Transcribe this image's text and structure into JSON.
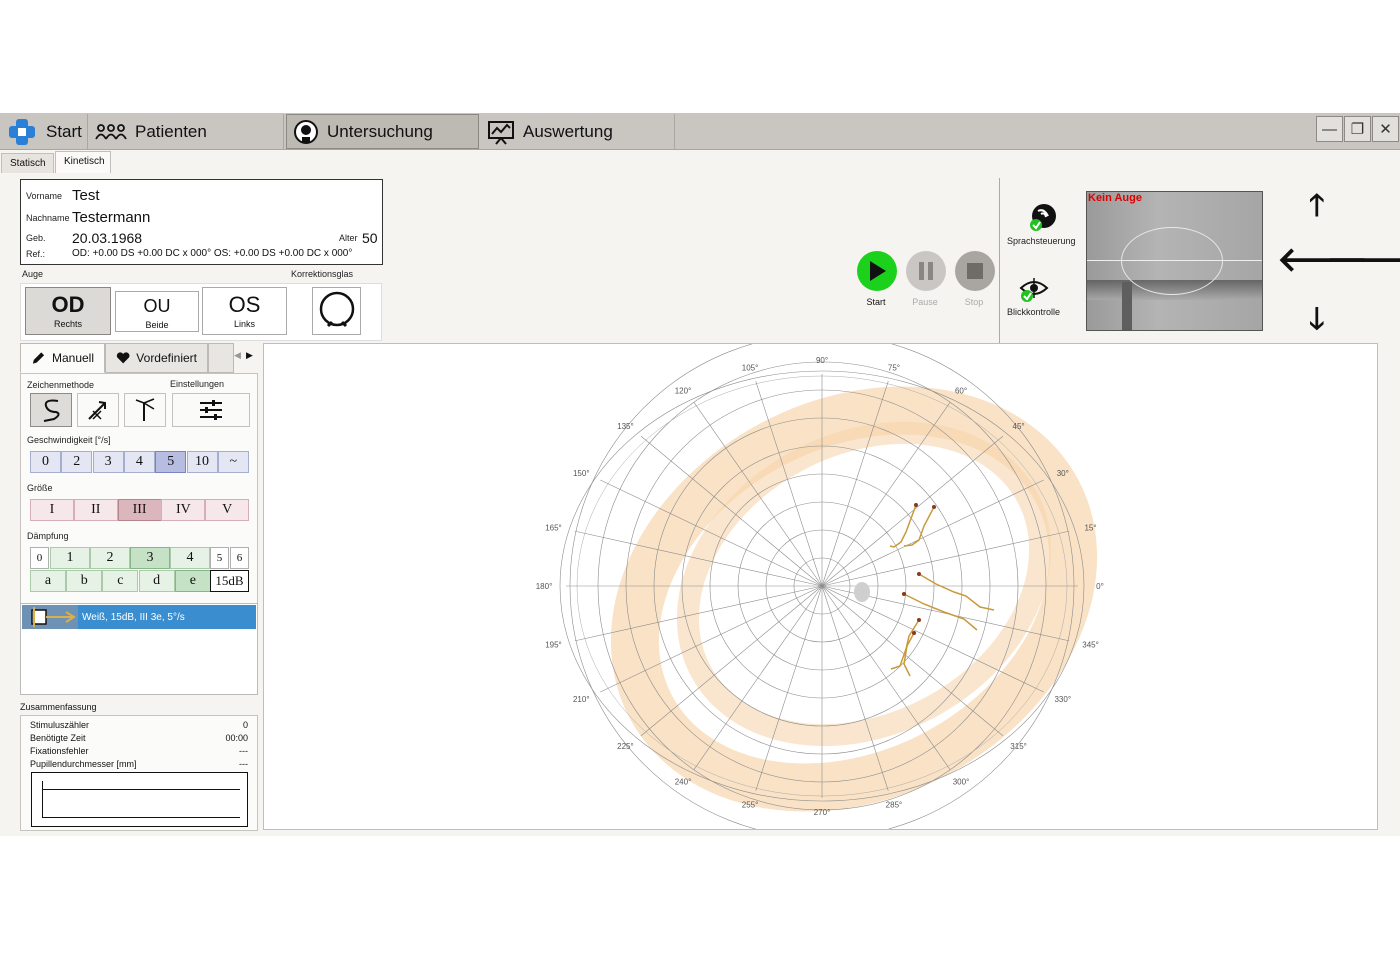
{
  "nav": {
    "tabs": [
      {
        "label": "Start",
        "icon": "logo-icon"
      },
      {
        "label": "Patienten",
        "icon": "patients-icon"
      },
      {
        "label": "Untersuchung",
        "icon": "exam-icon"
      },
      {
        "label": "Auswertung",
        "icon": "chart-icon"
      }
    ],
    "window_buttons": [
      "minimize",
      "restore",
      "close"
    ]
  },
  "subtabs": [
    "Statisch",
    "Kinetisch"
  ],
  "patient": {
    "vorname_label": "Vorname",
    "vorname": "Test",
    "nachname_label": "Nachname",
    "nachname": "Testermann",
    "geb_label": "Geb.",
    "geb": "20.03.1968",
    "alter_label": "Alter",
    "alter": "50",
    "ref_label": "Ref.:",
    "ref": "OD: +0.00 DS +0.00 DC x 000° OS: +0.00 DS +0.00 DC x 000°"
  },
  "auge": {
    "label": "Auge",
    "buttons": [
      {
        "big": "OD",
        "small": "Rechts",
        "active": true
      },
      {
        "big": "OU",
        "small": "Beide",
        "active": false
      },
      {
        "big": "OS",
        "small": "Links",
        "active": false
      }
    ],
    "korrektur_label": "Korrektionsglas"
  },
  "controls": {
    "start": "Start",
    "pause": "Pause",
    "stop": "Stop",
    "sprach": "Sprachsteuerung",
    "blick": "Blickkontrolle",
    "camera_label": "Kein Auge"
  },
  "leftpanel": {
    "tabs": [
      "Manuell",
      "Vordefiniert"
    ],
    "zeichen_label": "Zeichenmethode",
    "einst_label": "Einstellungen",
    "speed_label": "Geschwindigkeit [°/s]",
    "speeds": [
      "0",
      "2",
      "3",
      "4",
      "5",
      "10",
      "~"
    ],
    "speed_active": "5",
    "groesse_label": "Größe",
    "sizes": [
      "I",
      "II",
      "III",
      "IV",
      "V"
    ],
    "size_active": "III",
    "daempfung_label": "Dämpfung",
    "daempfung_nums": [
      "0",
      "1",
      "2",
      "3",
      "4",
      "5",
      "6"
    ],
    "daempfung_letters": [
      "a",
      "b",
      "c",
      "d",
      "e"
    ],
    "daempfung_active_num": "3",
    "daempfung_active_letter": "e",
    "daempfung_value": "15dB",
    "stimulus_entry": "Weiß, 15dB, III 3e, 5°/s"
  },
  "summary": {
    "label": "Zusammenfassung",
    "rows": [
      {
        "label": "Stimuluszähler",
        "value": "0"
      },
      {
        "label": "Benötigte Zeit",
        "value": "00:00"
      },
      {
        "label": "Fixationsfehler",
        "value": "---"
      },
      {
        "label": "Pupillendurchmesser [mm]",
        "value": "---"
      }
    ]
  },
  "perimeter": {
    "angle_labels": [
      "0°",
      "15°",
      "30°",
      "45°",
      "60°",
      "75°",
      "90°",
      "105°",
      "120°",
      "135°",
      "150°",
      "165°",
      "180°",
      "195°",
      "210°",
      "225°",
      "240°",
      "255°",
      "270°",
      "285°",
      "300°",
      "315°",
      "330°",
      "345°"
    ],
    "colors": {
      "band": "#f6d6ae",
      "trace": "#c89a3a",
      "dot": "#8a3b1a",
      "blind_spot": "#cfcfcf"
    }
  },
  "colors": {
    "play": "#1cd11c",
    "disabled": "#a9a6a2",
    "highlight": "#3a8ed0",
    "alert": "#e00000"
  }
}
